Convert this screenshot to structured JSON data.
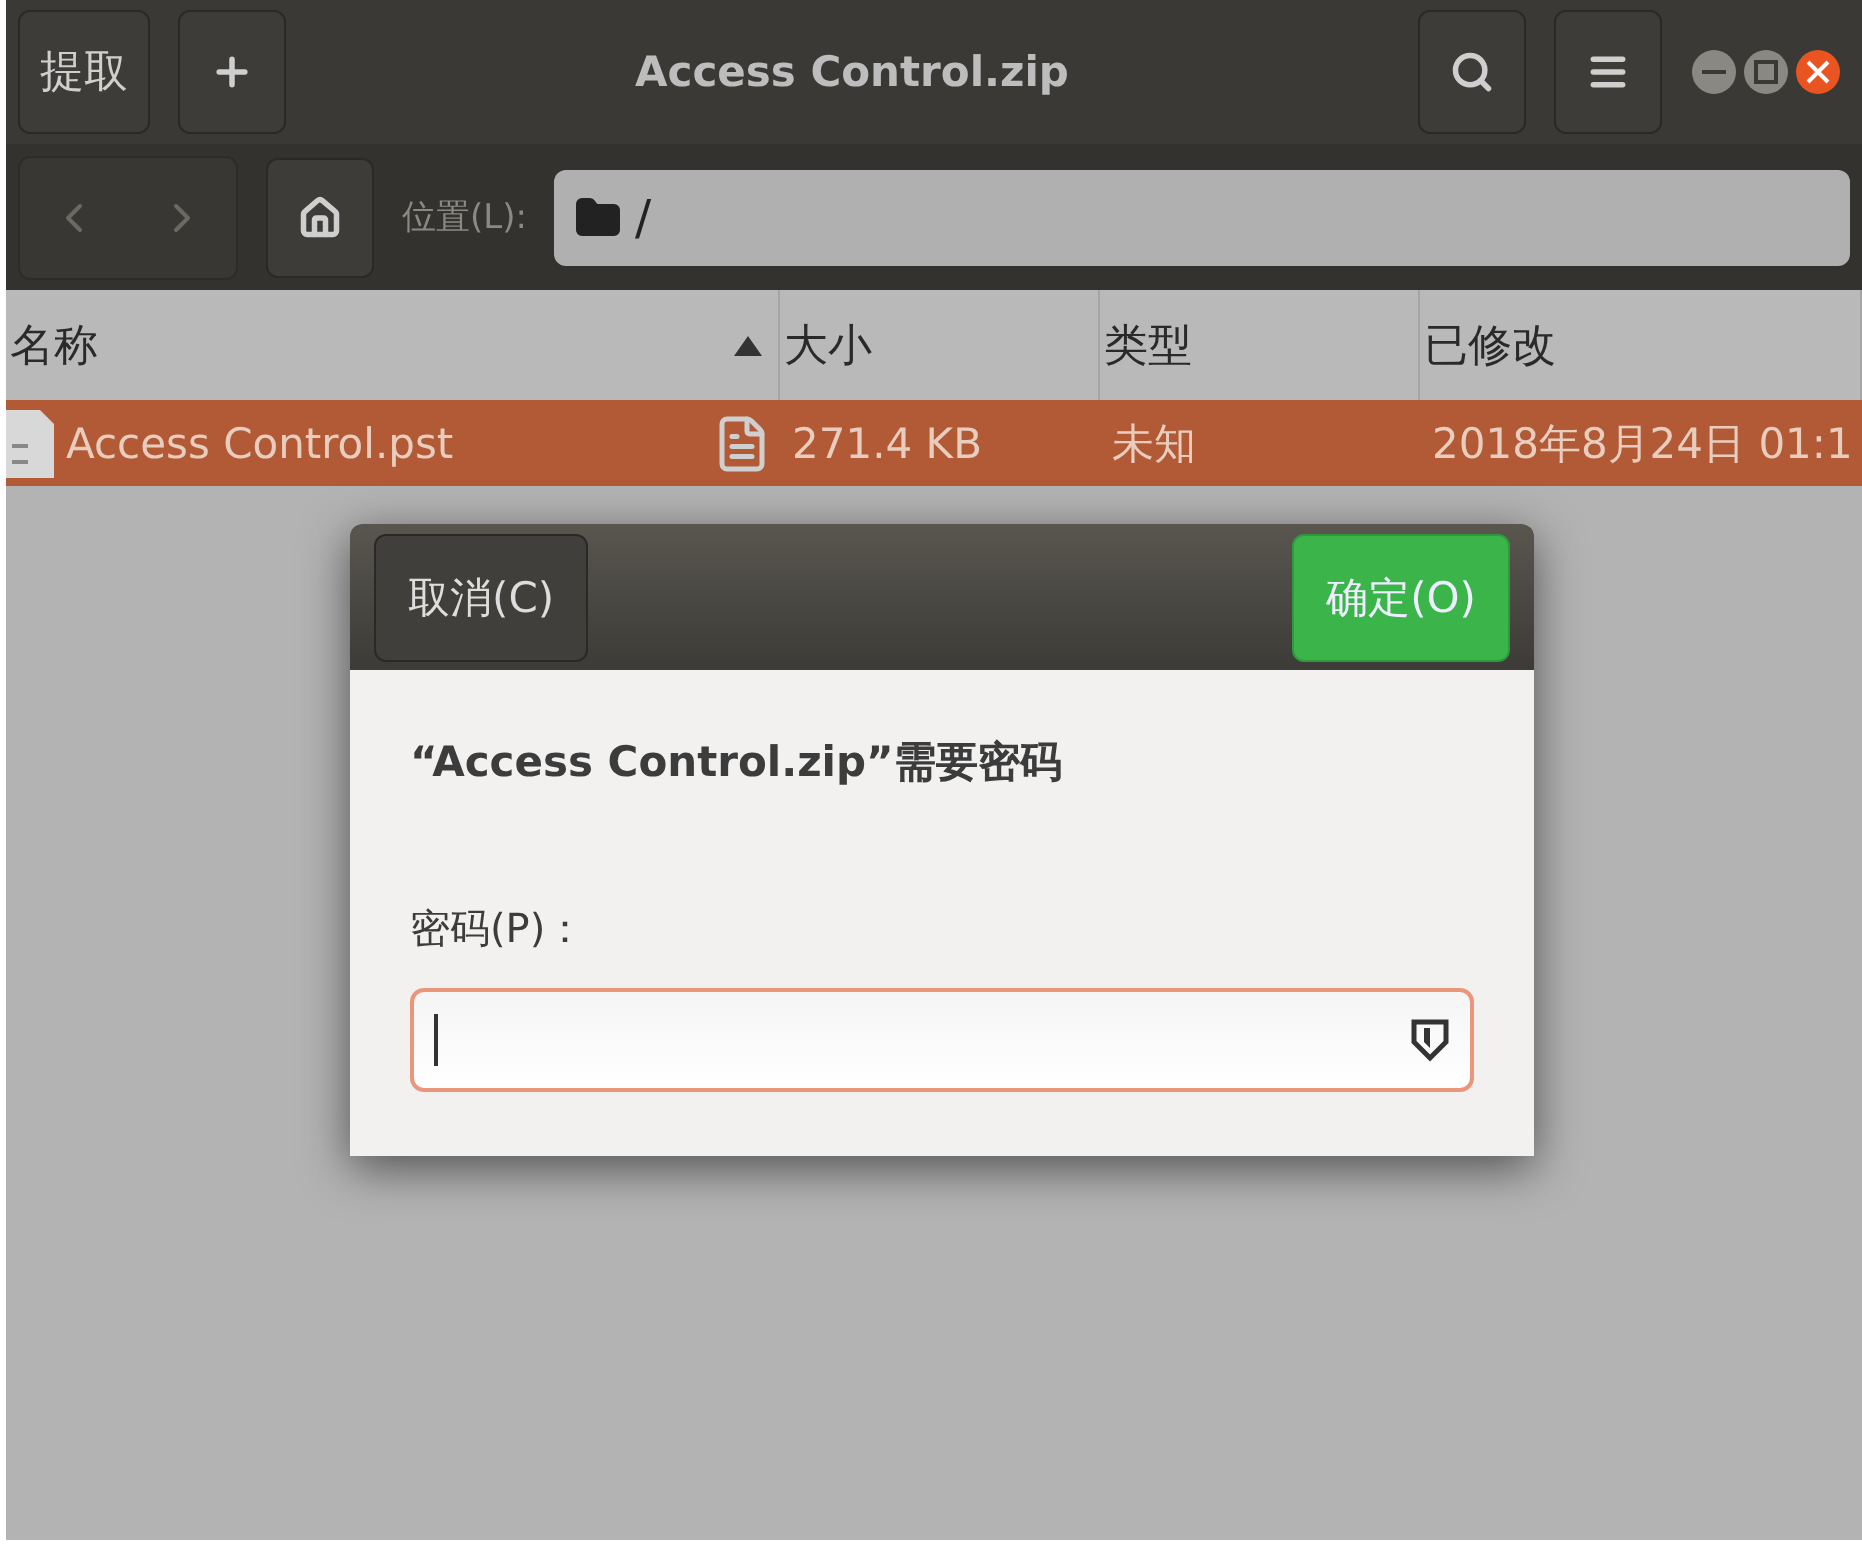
{
  "window": {
    "title": "Access Control.zip"
  },
  "toolbar": {
    "extract_button": "提取"
  },
  "location": {
    "label": "位置(L):",
    "path": "/"
  },
  "table": {
    "columns": [
      {
        "label": "名称",
        "sorted": true
      },
      {
        "label": "大小",
        "sorted": false
      },
      {
        "label": "类型",
        "sorted": false
      },
      {
        "label": "已修改",
        "sorted": false
      }
    ],
    "rows": [
      {
        "name": "Access Control.pst",
        "size": "271.4 KB",
        "type": "未知",
        "modified": "2018年8月24日 01:1",
        "selected": true
      }
    ]
  },
  "dialog": {
    "cancel_button": "取消(C)",
    "confirm_button": "确定(O)",
    "message": "“Access Control.zip”需要密码",
    "field_label": "密码(P)：",
    "field_focused": true
  }
}
